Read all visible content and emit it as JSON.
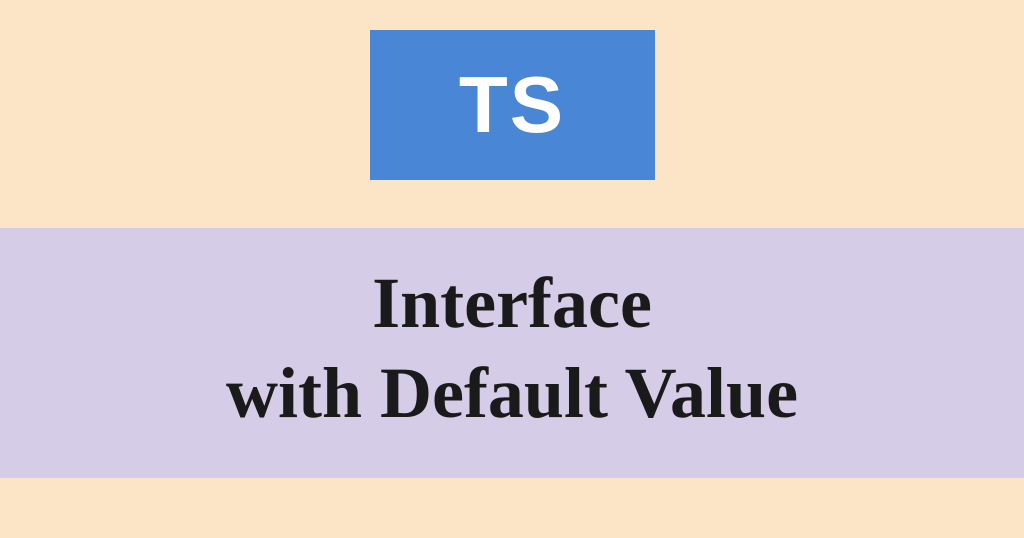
{
  "logo": {
    "label": "TS"
  },
  "title": {
    "line1": "Interface",
    "line2": "with Default Value"
  },
  "colors": {
    "background": "#fce5c6",
    "logoBox": "#4a86d6",
    "logoText": "#ffffff",
    "band": "#d5cce8",
    "titleText": "#1a1a1a"
  }
}
